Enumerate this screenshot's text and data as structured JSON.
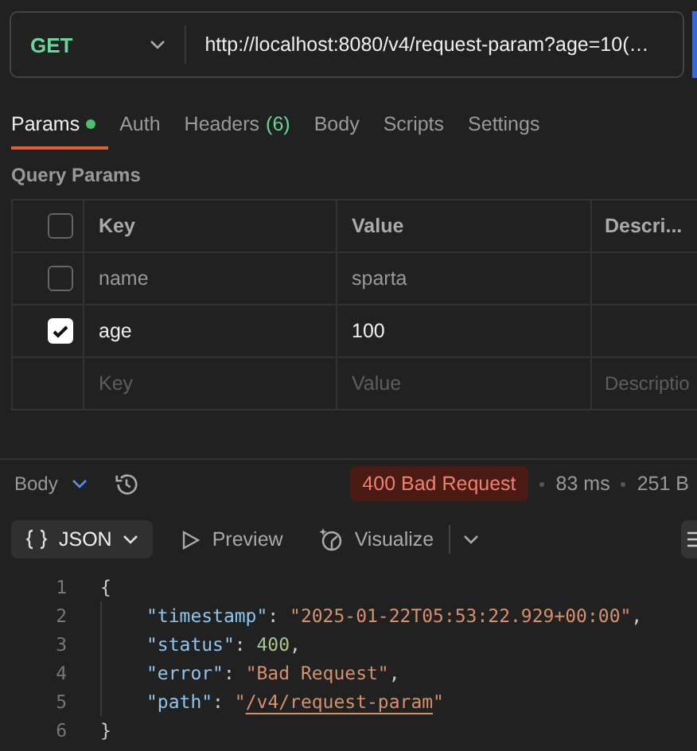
{
  "request": {
    "method": "GET",
    "url": "http://localhost:8080/v4/request-param?age=10(…"
  },
  "tabs": [
    {
      "label": "Params",
      "selected": true,
      "dot": true
    },
    {
      "label": "Auth",
      "selected": false,
      "dot": false
    },
    {
      "label": "Headers",
      "count": "(6)",
      "selected": false,
      "dot": false
    },
    {
      "label": "Body",
      "selected": false,
      "dot": false
    },
    {
      "label": "Scripts",
      "selected": false,
      "dot": false
    },
    {
      "label": "Settings",
      "selected": false,
      "dot": false
    }
  ],
  "query_params": {
    "title": "Query Params",
    "columns": [
      {
        "label": "Key"
      },
      {
        "label": "Value"
      },
      {
        "label": "Descri..."
      }
    ],
    "header_checked": false,
    "rows": [
      {
        "key": "name",
        "value": "sparta",
        "checked": false
      },
      {
        "key": "age",
        "value": "100",
        "checked": true
      }
    ],
    "new_row": {
      "key_placeholder": "Key",
      "value_placeholder": "Value",
      "description_placeholder": "Descriptio"
    }
  },
  "response": {
    "body_label": "Body",
    "status": "400 Bad Request",
    "time": "83 ms",
    "size": "251 B",
    "view_modes": [
      {
        "label": "JSON",
        "kind": "dropdown",
        "selected": true
      },
      {
        "label": "Preview",
        "kind": "preview",
        "selected": false
      },
      {
        "label": "Visualize",
        "kind": "visualize",
        "selected": false
      }
    ],
    "code": [
      {
        "number": "1",
        "tokens": [
          {
            "kind": "punct",
            "text": "{"
          }
        ],
        "children": [
          {
            "number": "2",
            "tokens": [
              {
                "kind": "key",
                "text": "\"timestamp\""
              },
              {
                "kind": "punct",
                "text": ": "
              },
              {
                "kind": "string",
                "text": "\"2025-01-22T05:53:22.929+00:00\""
              },
              {
                "kind": "punct",
                "text": ","
              }
            ]
          },
          {
            "number": "3",
            "tokens": [
              {
                "kind": "key",
                "text": "\"status\""
              },
              {
                "kind": "punct",
                "text": ": "
              },
              {
                "kind": "number",
                "text": "400"
              },
              {
                "kind": "punct",
                "text": ","
              }
            ]
          },
          {
            "number": "4",
            "tokens": [
              {
                "kind": "key",
                "text": "\"error\""
              },
              {
                "kind": "punct",
                "text": ": "
              },
              {
                "kind": "string",
                "text": "\"Bad Request\""
              },
              {
                "kind": "punct",
                "text": ","
              }
            ]
          },
          {
            "number": "5",
            "tokens": [
              {
                "kind": "key",
                "text": "\"path\""
              },
              {
                "kind": "punct",
                "text": ": "
              },
              {
                "kind": "string",
                "text": "\""
              },
              {
                "kind": "link",
                "text": "/v4/request-param"
              },
              {
                "kind": "string",
                "text": "\""
              }
            ]
          }
        ]
      },
      {
        "number": "6",
        "tokens": [
          {
            "kind": "punct",
            "text": "}"
          }
        ]
      }
    ]
  }
}
